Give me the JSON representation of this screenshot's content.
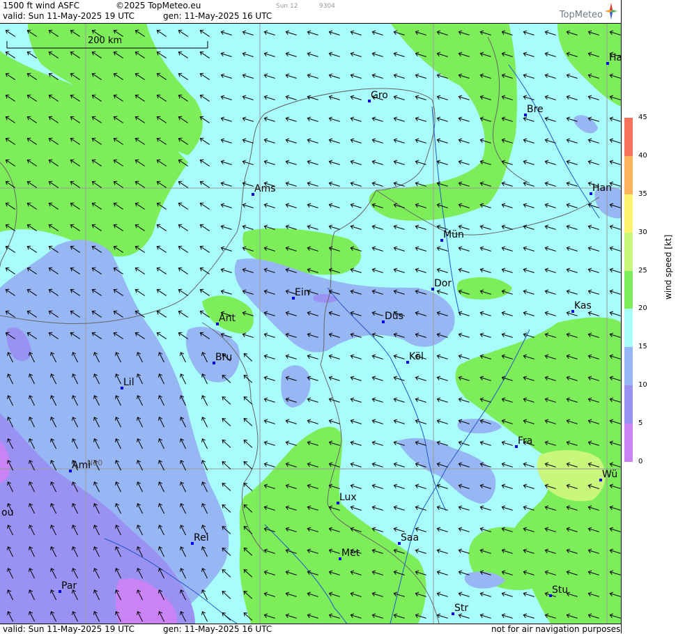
{
  "header": {
    "product": "1500 ft wind ASFC",
    "copyright": "©2025 TopMeteo.eu",
    "valid": "valid:  Sun  11-May-2025  19 UTC",
    "generated": "gen: 11-May-2025 16 UTC",
    "tiny_day": "Sun 12",
    "tiny_code": "9304",
    "logo": "TopMeteo"
  },
  "footer": {
    "valid": "valid:  Sun  11-May-2025  19 UTC",
    "generated": "gen: 11-May-2025 16 UTC",
    "disclaimer": "not for air navigation purposes"
  },
  "map": {
    "scale_label": "200 km",
    "lat_label": "N50",
    "cities": [
      {
        "name": "Gro"
      },
      {
        "name": "Bre"
      },
      {
        "name": "Ha"
      },
      {
        "name": "Ams"
      },
      {
        "name": "Han"
      },
      {
        "name": "Mün"
      },
      {
        "name": "Dor"
      },
      {
        "name": "Ein"
      },
      {
        "name": "Kas"
      },
      {
        "name": "Ant"
      },
      {
        "name": "Düs"
      },
      {
        "name": "Bru"
      },
      {
        "name": "Köl"
      },
      {
        "name": "Lil"
      },
      {
        "name": "Fra"
      },
      {
        "name": "Ami"
      },
      {
        "name": "Wü"
      },
      {
        "name": "Lux"
      },
      {
        "name": "Rei"
      },
      {
        "name": "Saa"
      },
      {
        "name": "Met"
      },
      {
        "name": "Stu"
      },
      {
        "name": "Par"
      },
      {
        "name": "Str"
      },
      {
        "name": "ou"
      }
    ],
    "colors": {
      "kt_0_5": "#c983f5",
      "kt_5_10": "#9a92f2",
      "kt_10_15": "#97b6f4",
      "kt_15_20": "#a8fcfc",
      "kt_20_25": "#7dee5a",
      "kt_25_30": "#c8f77c",
      "kt_30_35": "#fef36f",
      "kt_35_40": "#fdb35c",
      "kt_40_45": "#f7725c"
    }
  },
  "legend": {
    "title": "wind  speed  [kt]",
    "ticks": [
      "45",
      "40",
      "35",
      "30",
      "25",
      "20",
      "15",
      "10",
      "5",
      "0"
    ],
    "colors": [
      "#f7725c",
      "#fdb35c",
      "#fef36f",
      "#c8f77c",
      "#7dee5a",
      "#a8fcfc",
      "#97b6f4",
      "#9a92f2",
      "#c983f5"
    ]
  }
}
